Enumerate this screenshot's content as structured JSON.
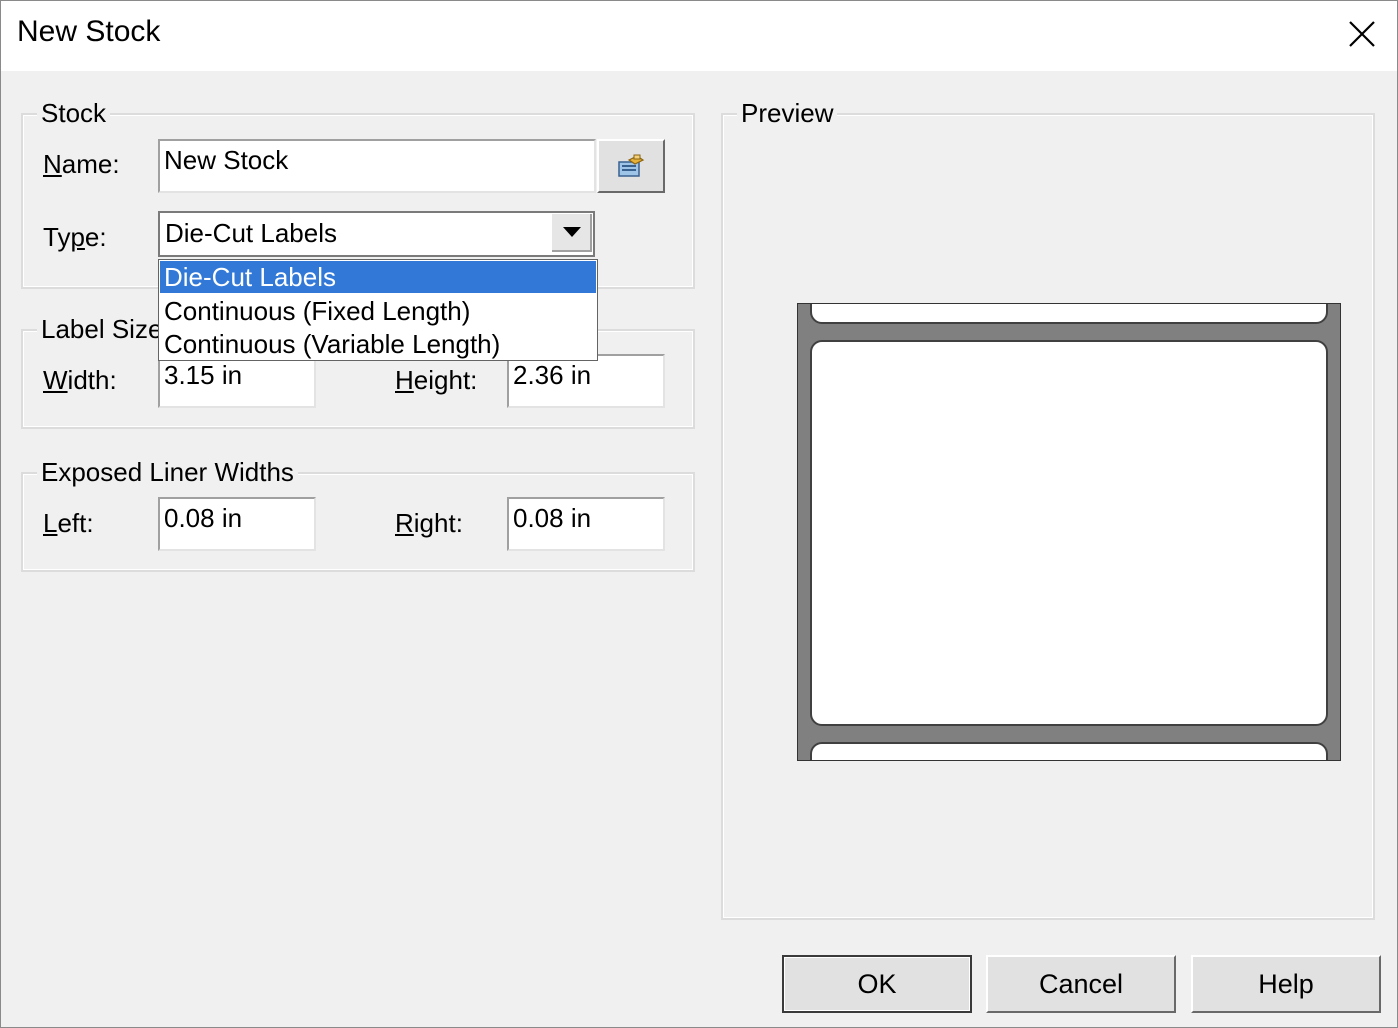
{
  "window": {
    "title": "New Stock"
  },
  "stock": {
    "legend": "Stock",
    "name_label": "Name:",
    "name_value": "New Stock",
    "type_label": "Type:",
    "type_value": "Die-Cut Labels",
    "type_options": [
      "Die-Cut Labels",
      "Continuous (Fixed Length)",
      "Continuous (Variable Length)"
    ],
    "browse_icon": "stock-library-icon"
  },
  "label_size": {
    "legend": "Label Size",
    "width_label": "Width:",
    "width_value": "3.15 in",
    "height_label": "Height:",
    "height_value": "2.36 in"
  },
  "liner": {
    "legend": "Exposed Liner Widths",
    "left_label": "Left:",
    "left_value": "0.08 in",
    "right_label": "Right:",
    "right_value": "0.08 in"
  },
  "preview": {
    "legend": "Preview"
  },
  "buttons": {
    "ok": "OK",
    "cancel": "Cancel",
    "help": "Help"
  },
  "colors": {
    "selection": "#3279d7",
    "dialog_bg": "#f0f0f0",
    "liner": "#808080"
  }
}
